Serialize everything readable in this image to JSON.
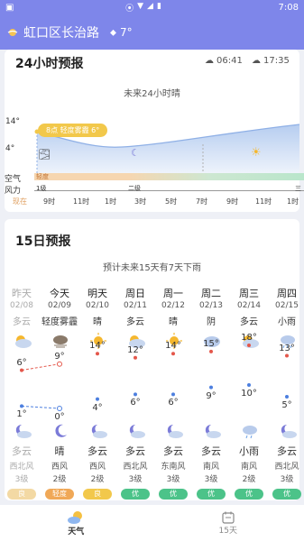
{
  "status": {
    "time": "7:08"
  },
  "topbar": {
    "location": "虹口区长治路",
    "temperature": "7°"
  },
  "hourly": {
    "title": "24小时预报",
    "sunrise": "06:41",
    "sunset": "17:35",
    "summary": "未来24小时晴",
    "y_labels": [
      "14°",
      "4°"
    ],
    "tooltip": "8点 轻度雾霾 6°",
    "air_label": "空气",
    "wind_label": "风力",
    "wind_levels": [
      "1级",
      "二级",
      "三"
    ],
    "hours": [
      "现在",
      "9时",
      "11时",
      "1时",
      "3时",
      "5时",
      "7时",
      "9时",
      "11时",
      "1时"
    ],
    "aqi_start": "轻度"
  },
  "daily": {
    "title": "15日预报",
    "summary": "预计未来15天有7天下雨",
    "days": [
      {
        "name": "昨天",
        "date": "02/08",
        "cond": "多云",
        "hi": "6°",
        "lo": "1°",
        "n_cond": "多云",
        "n_wind": "西北风",
        "n_lv": "3级",
        "aqi": "良",
        "aqi_color": "#f3d9a4",
        "icon": "cloud-sun",
        "past": true
      },
      {
        "name": "今天",
        "date": "02/09",
        "cond": "轻度雾霾",
        "hi": "9°",
        "lo": "0°",
        "n_cond": "晴",
        "n_wind": "西风",
        "n_lv": "2级",
        "aqi": "轻度",
        "aqi_color": "#f0a857",
        "icon": "haze",
        "past": false
      },
      {
        "name": "明天",
        "date": "02/10",
        "cond": "晴",
        "hi": "14°",
        "lo": "4°",
        "n_cond": "多云",
        "n_wind": "西风",
        "n_lv": "2级",
        "aqi": "良",
        "aqi_color": "#f2c84b",
        "icon": "sun",
        "past": false
      },
      {
        "name": "周日",
        "date": "02/11",
        "cond": "多云",
        "hi": "12°",
        "lo": "6°",
        "n_cond": "多云",
        "n_wind": "西北风",
        "n_lv": "3级",
        "aqi": "优",
        "aqi_color": "#4cc389",
        "icon": "cloud-sun",
        "past": false
      },
      {
        "name": "周一",
        "date": "02/12",
        "cond": "晴",
        "hi": "14°",
        "lo": "6°",
        "n_cond": "多云",
        "n_wind": "东南风",
        "n_lv": "3级",
        "aqi": "优",
        "aqi_color": "#4cc389",
        "icon": "sun",
        "past": false
      },
      {
        "name": "周二",
        "date": "02/13",
        "cond": "阴",
        "hi": "15°",
        "lo": "9°",
        "n_cond": "多云",
        "n_wind": "南风",
        "n_lv": "3级",
        "aqi": "优",
        "aqi_color": "#4cc389",
        "icon": "cloud",
        "past": false
      },
      {
        "name": "周三",
        "date": "02/14",
        "cond": "多云",
        "hi": "18°",
        "lo": "10°",
        "n_cond": "小雨",
        "n_wind": "南风",
        "n_lv": "2级",
        "aqi": "优",
        "aqi_color": "#4cc389",
        "icon": "cloud-sun",
        "past": false
      },
      {
        "name": "周四",
        "date": "02/15",
        "cond": "小雨",
        "hi": "13°",
        "lo": "5°",
        "n_cond": "多云",
        "n_wind": "西北风",
        "n_lv": "3级",
        "aqi": "优",
        "aqi_color": "#4cc389",
        "icon": "rain",
        "past": false
      }
    ]
  },
  "nav": {
    "weather": "天气",
    "fifteen": "15天"
  }
}
